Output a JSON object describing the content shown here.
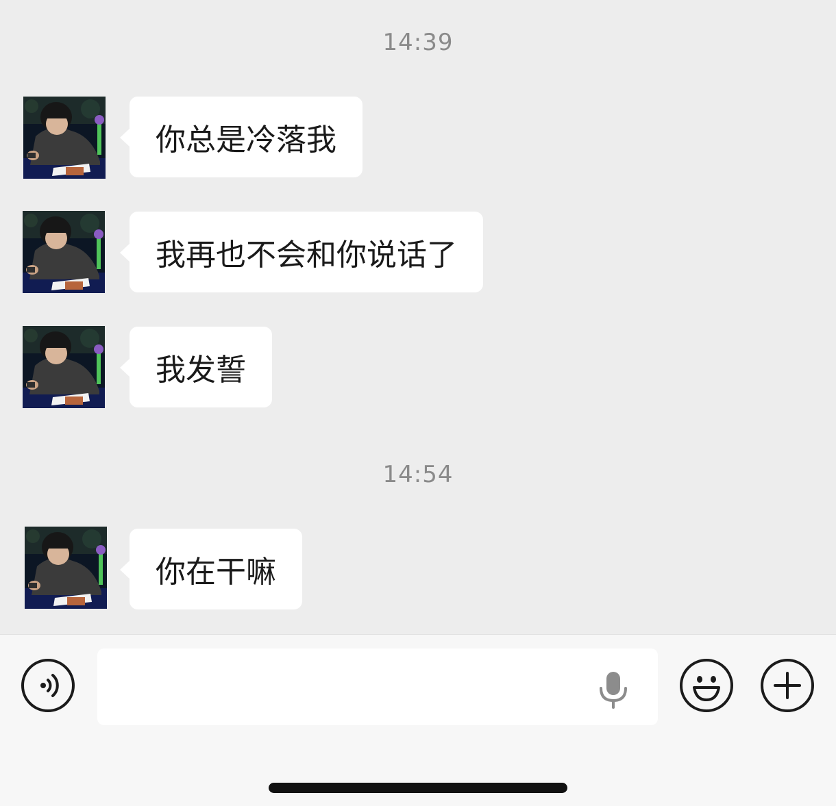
{
  "conversation": {
    "groups": [
      {
        "time": "14:39",
        "messages": [
          {
            "text": "你总是冷落我"
          },
          {
            "text": "我再也不会和你说话了"
          },
          {
            "text": "我发誓"
          }
        ]
      },
      {
        "time": "14:54",
        "messages": [
          {
            "text": "你在干嘛"
          }
        ]
      }
    ]
  },
  "input_bar": {
    "message_input_value": "",
    "voice_toggle_icon": "voice-wave-icon",
    "mic_icon": "microphone-icon",
    "emoji_icon": "smiley-face-icon",
    "more_icon": "plus-icon"
  },
  "colors": {
    "background": "#ededed",
    "bubble": "#ffffff",
    "timestamp_text": "#8a8a8a",
    "input_bar": "#f7f7f7"
  }
}
